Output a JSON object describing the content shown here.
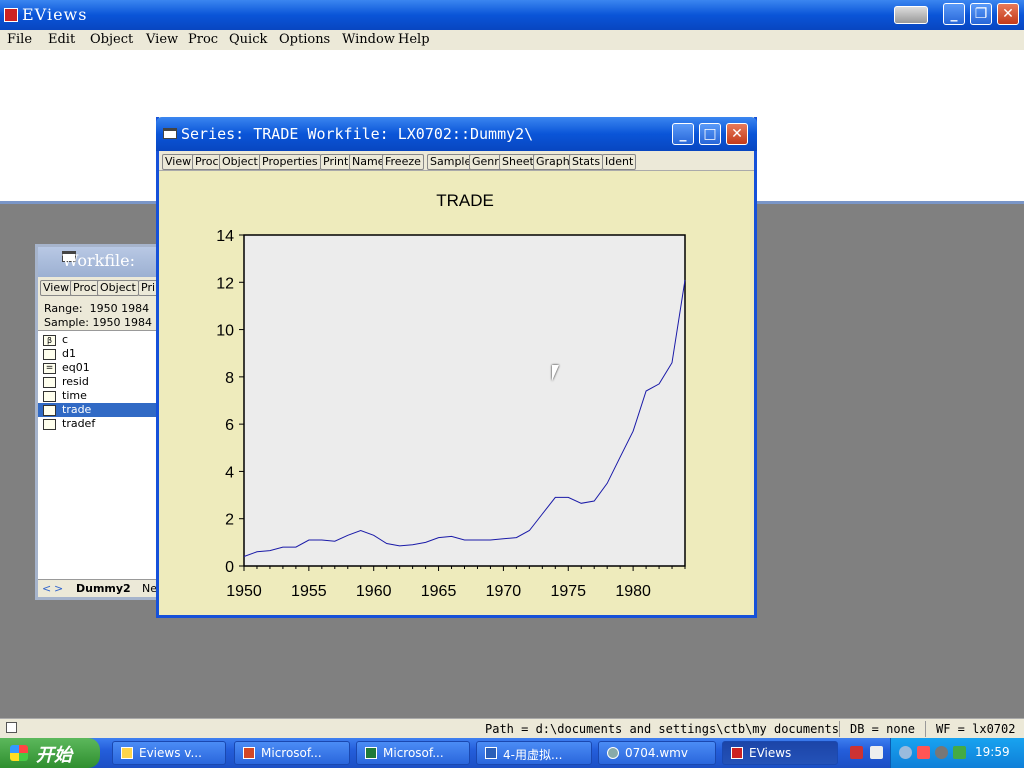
{
  "app": {
    "title": "EViews",
    "menu": [
      "File",
      "Edit",
      "Object",
      "View",
      "Proc",
      "Quick",
      "Options",
      "Window",
      "Help"
    ]
  },
  "workfile_window": {
    "title": "Workfile:",
    "toolbar": [
      "View",
      "Proc",
      "Object",
      "Pri"
    ],
    "range_label": "Range:",
    "range_value": "1950 1984",
    "sample_label": "Sample:",
    "sample_value": "1950 1984",
    "items": [
      {
        "name": "c",
        "icon": "coef-icon"
      },
      {
        "name": "d1",
        "icon": "series-icon"
      },
      {
        "name": "eq01",
        "icon": "equation-icon"
      },
      {
        "name": "resid",
        "icon": "series-icon"
      },
      {
        "name": "time",
        "icon": "series-icon"
      },
      {
        "name": "trade",
        "icon": "series-icon",
        "selected": true
      },
      {
        "name": "tradef",
        "icon": "series-icon"
      }
    ],
    "tabs": [
      "Dummy2",
      "Ne"
    ]
  },
  "series_window": {
    "title": "Series: TRADE   Workfile: LX0702::Dummy2\\",
    "toolbar": [
      "View",
      "Proc",
      "Object",
      "Properties",
      "Print",
      "Name",
      "Freeze",
      "Sample",
      "Genr",
      "Sheet",
      "Graph",
      "Stats",
      "Ident"
    ]
  },
  "chart_data": {
    "type": "line",
    "title": "TRADE",
    "xlabel": "",
    "ylabel": "",
    "xlim": [
      1950,
      1984
    ],
    "ylim": [
      0,
      14
    ],
    "xticks": [
      1950,
      1955,
      1960,
      1965,
      1970,
      1975,
      1980
    ],
    "yticks": [
      0,
      2,
      4,
      6,
      8,
      10,
      12,
      14
    ],
    "grid": false,
    "color": "#1a1aa8",
    "series": [
      {
        "x": [
          1950,
          1951,
          1952,
          1953,
          1954,
          1955,
          1956,
          1957,
          1958,
          1959,
          1960,
          1961,
          1962,
          1963,
          1964,
          1965,
          1966,
          1967,
          1968,
          1969,
          1970,
          1971,
          1972,
          1973,
          1974,
          1975,
          1976,
          1977,
          1978,
          1979,
          1980,
          1981,
          1982,
          1983,
          1984
        ],
        "y": [
          0.4,
          0.6,
          0.65,
          0.8,
          0.8,
          1.1,
          1.1,
          1.05,
          1.3,
          1.5,
          1.3,
          0.95,
          0.85,
          0.9,
          1.0,
          1.2,
          1.25,
          1.1,
          1.1,
          1.1,
          1.15,
          1.2,
          1.5,
          2.2,
          2.9,
          2.9,
          2.65,
          2.75,
          3.5,
          4.6,
          5.7,
          7.4,
          7.7,
          8.6,
          12.1
        ]
      }
    ]
  },
  "statusbar": {
    "path": "Path = d:\\documents and settings\\ctb\\my documents",
    "db": "DB = none",
    "wf": "WF = lx0702"
  },
  "taskbar": {
    "start": "开始",
    "tasks": [
      "Eviews v...",
      "Microsof...",
      "Microsof...",
      "4-用虚拟...",
      "0704.wmv",
      "EViews"
    ],
    "clock": "19:59"
  }
}
